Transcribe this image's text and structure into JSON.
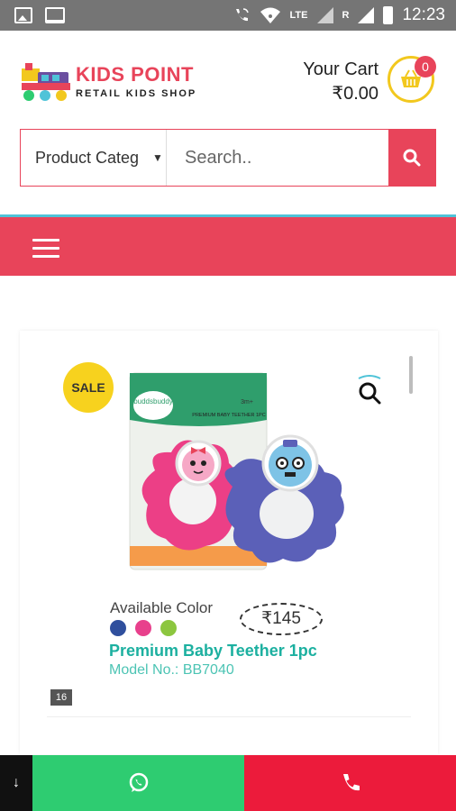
{
  "status_bar": {
    "network_label": "LTE",
    "sim_label": "R",
    "time": "12:23",
    "icons": [
      "image-icon",
      "laptop-icon",
      "wifi-calling-icon",
      "wifi-icon",
      "signal-icon",
      "battery-icon"
    ]
  },
  "header": {
    "logo_title": "KIDS POINT",
    "logo_subtitle": "RETAIL  KIDS SHOP",
    "cart_label": "Your Cart",
    "cart_total": "₹0.00",
    "cart_count": "0"
  },
  "search": {
    "category_label": "Product Categ",
    "placeholder": "Search.."
  },
  "nav": {
    "menu_icon": "hamburger-icon"
  },
  "product": {
    "badge": "SALE",
    "available_label": "Available Color",
    "colors": [
      "#2f4f9d",
      "#e8408c",
      "#8cc63f"
    ],
    "price": "₹145",
    "name": "Premium Baby Teether 1pc",
    "model": "Model No.: BB7040",
    "counter": "16",
    "package_brand": "buddsbuddy",
    "package_text": "PREMIUM BABY TEETHER 1PC",
    "package_age": "3m+"
  },
  "bottom_bar": {
    "left_icon": "arrow-down-icon",
    "whatsapp_icon": "whatsapp-icon",
    "call_icon": "phone-icon"
  },
  "colors": {
    "accent": "#e8445a",
    "sale_badge": "#f7d21e",
    "teal_text": "#1cb0a0",
    "whatsapp_green": "#2ecc71",
    "call_red": "#ec1b3b",
    "status_bar": "#757575"
  }
}
